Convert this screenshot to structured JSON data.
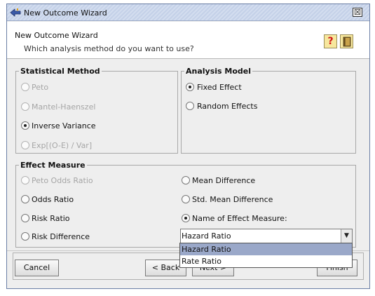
{
  "window": {
    "title": "New Outcome Wizard",
    "close_glyph": "☒"
  },
  "header": {
    "title": "New Outcome Wizard",
    "subtitle": "Which analysis method do you want to use?",
    "help_glyph": "?"
  },
  "statistical_method": {
    "title": "Statistical Method",
    "options": [
      {
        "label": "Peto",
        "selected": false,
        "enabled": false
      },
      {
        "label": "Mantel-Haenszel",
        "selected": false,
        "enabled": false
      },
      {
        "label": "Inverse Variance",
        "selected": true,
        "enabled": true
      },
      {
        "label": "Exp[(O-E) / Var]",
        "selected": false,
        "enabled": false
      }
    ]
  },
  "analysis_model": {
    "title": "Analysis Model",
    "options": [
      {
        "label": "Fixed Effect",
        "selected": true
      },
      {
        "label": "Random Effects",
        "selected": false
      }
    ]
  },
  "effect_measure": {
    "title": "Effect Measure",
    "left_options": [
      {
        "label": "Peto Odds Ratio",
        "selected": false,
        "enabled": false
      },
      {
        "label": "Odds Ratio",
        "selected": false,
        "enabled": true
      },
      {
        "label": "Risk Ratio",
        "selected": false,
        "enabled": true
      },
      {
        "label": "Risk Difference",
        "selected": false,
        "enabled": true
      }
    ],
    "right_options": [
      {
        "label": "Mean Difference",
        "selected": false
      },
      {
        "label": "Std. Mean Difference",
        "selected": false
      },
      {
        "label": "Name of Effect Measure:",
        "selected": true
      }
    ],
    "name_combo": {
      "value": "Hazard Ratio",
      "arrow_glyph": "▼",
      "options": [
        "Hazard Ratio",
        "Rate Ratio"
      ],
      "highlighted": "Hazard Ratio"
    }
  },
  "footer": {
    "cancel": "Cancel",
    "back": "< Back",
    "next": "Next >",
    "finish": "Finish"
  },
  "colors": {
    "title_bar": "#c4d1e8",
    "panel_bg": "#eeeeee",
    "selection": "#9aa8c9",
    "help_accent": "#d01818",
    "header_button": "#f7e79d"
  },
  "icons": {
    "window_icon": "wizard-arrow-icon",
    "help_icon": "question-mark-icon",
    "book_icon": "book-icon",
    "close_icon": "close-box-icon",
    "dropdown_icon": "chevron-down-icon"
  }
}
